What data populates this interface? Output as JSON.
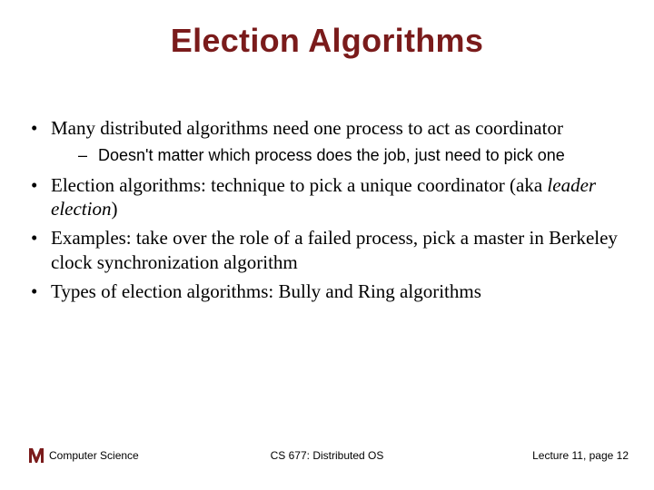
{
  "title": "Election Algorithms",
  "bullets": {
    "b1": "Many distributed algorithms need one process to act as coordinator",
    "b1_sub": "Doesn't matter which process does the job, just need to pick one",
    "b2_pre": "Election algorithms: technique to pick a unique coordinator (aka ",
    "b2_italic": "leader election",
    "b2_post": ")",
    "b3": "Examples: take over the role of a failed process, pick a master in Berkeley clock synchronization algorithm",
    "b4": "Types of election algorithms: Bully and Ring algorithms"
  },
  "footer": {
    "left": "Computer Science",
    "center": "CS 677: Distributed OS",
    "right": "Lecture 11, page 12"
  }
}
